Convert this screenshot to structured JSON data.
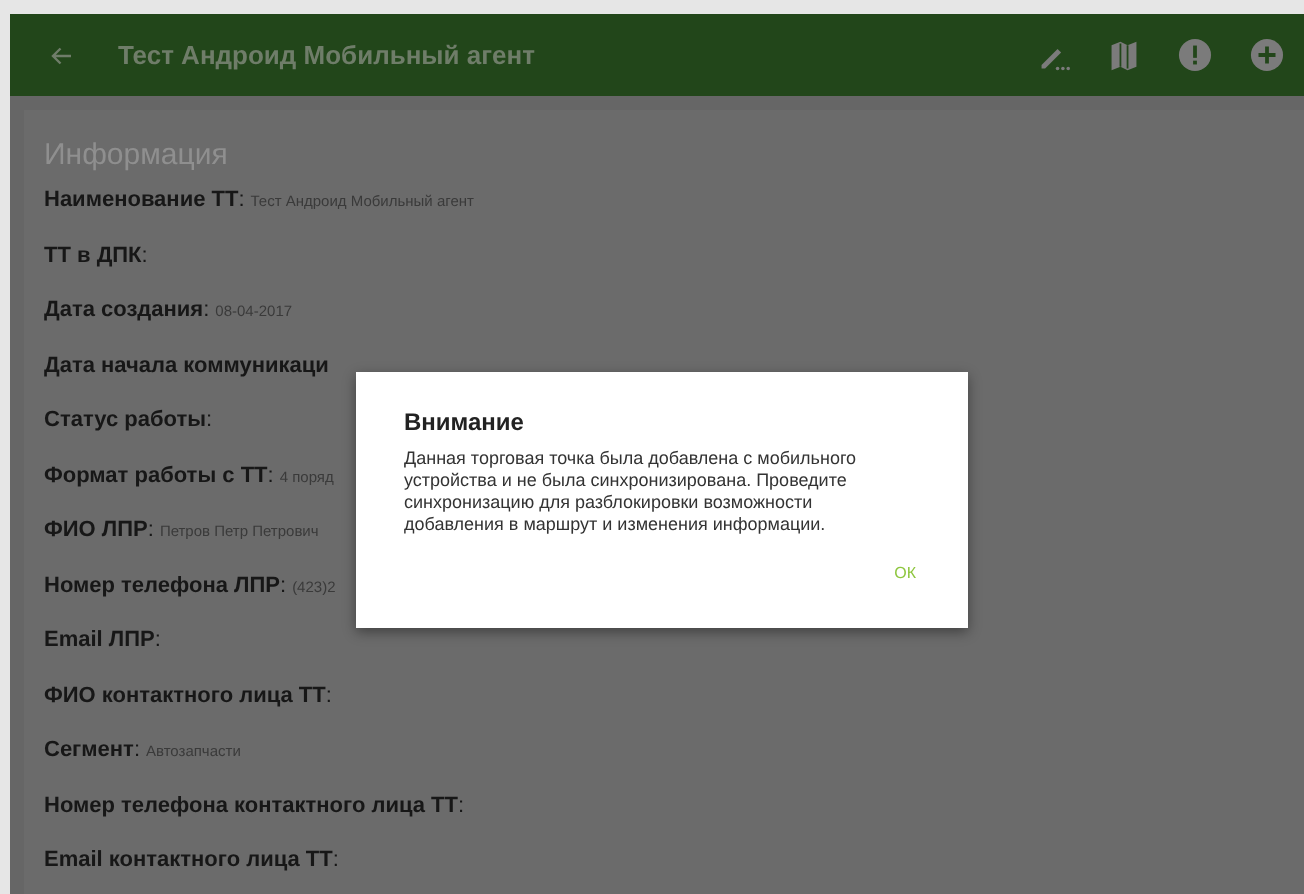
{
  "app_bar": {
    "title": "Тест Андроид Мобильный агент"
  },
  "section": {
    "title": "Информация"
  },
  "fields": [
    {
      "label": "**Наименование ТТ**:",
      "value": "Тест Андроид Мобильный агент"
    },
    {
      "label": "**ТТ в ДПК**:"
    },
    {
      "label": "**Дата создания**:",
      "value": "08-04-2017"
    },
    {
      "label": "**Дата начала коммуникаци**"
    },
    {
      "label": "**Статус работы**:"
    },
    {
      "label": "**Формат работы с ТТ**:",
      "value": "4 поряд"
    },
    {
      "label": "**ФИО ЛПР**:",
      "value": "Петров Петр Петрович"
    },
    {
      "label": "**Номер телефона ЛПР**:",
      "value": "(423)2"
    },
    {
      "label": "**Email ЛПР**:"
    },
    {
      "label": "**ФИО контактного лица ТТ**:"
    },
    {
      "label": "**Сегмент**:",
      "value": "Автозапчасти"
    },
    {
      "label": "**Номер телефона контактного лица ТТ**:"
    },
    {
      "label": "**Email контактного лица ТТ**:"
    }
  ],
  "dialog": {
    "title": "Внимание",
    "message": "Данная торговая точка была добавлена с мобильного устройства и не была синхронизирована. Проведите синхронизацию для разблокировки возможности добавления в маршрут и изменения информации.",
    "button": "ОК"
  }
}
